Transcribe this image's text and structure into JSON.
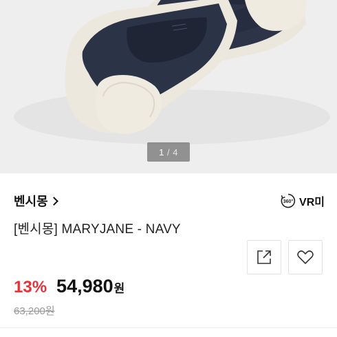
{
  "gallery": {
    "current": "1",
    "separator": "/",
    "total": "4"
  },
  "product": {
    "brand": "벤시몽",
    "vr_label": "VR미",
    "vr_badge": "360°",
    "name": "[벤시몽] MARYJANE - NAVY"
  },
  "pricing": {
    "discount": "13%",
    "price": "54,980",
    "currency": "원",
    "original_price": "63,200원"
  },
  "icons": {
    "share": "share-icon",
    "like": "heart-icon",
    "vr": "360-view-icon",
    "brand_link": "chevron-right-icon"
  },
  "colors": {
    "discount": "#e8323a",
    "shoe_canvas": "#2b3346",
    "shoe_sole": "#ede9df",
    "background": "#eeeeee"
  }
}
